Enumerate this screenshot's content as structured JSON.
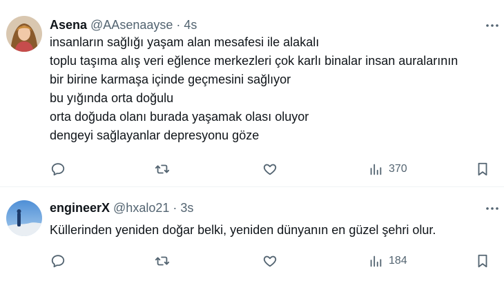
{
  "tweets": [
    {
      "author_name": "Asena",
      "handle": "@AAsenaayse",
      "separator": "·",
      "time": "4s",
      "lines": [
        "insanların sağlığı yaşam alan mesafesi ile alakalı",
        "toplu taşıma alış veri  eğlence merkezleri çok karlı binalar insan auralarının",
        "bir birine karmaşa içinde geçmesini sağlıyor",
        "bu yığında orta doğulu",
        "orta doğuda olanı burada yaşamak olası oluyor",
        "dengeyi sağlayanlar depresyonu göze"
      ],
      "views": "370",
      "icons": {
        "reply": "reply-icon",
        "retweet": "retweet-icon",
        "like": "heart-icon",
        "views": "views-icon",
        "bookmark": "bookmark-icon",
        "more": "more-icon"
      }
    },
    {
      "author_name": "engineerX",
      "handle": "@hxalo21",
      "separator": "·",
      "time": "3s",
      "lines": [
        "Küllerinden yeniden doğar belki, yeniden dünyanın en güzel şehri olur."
      ],
      "views": "184",
      "icons": {
        "reply": "reply-icon",
        "retweet": "retweet-icon",
        "like": "heart-icon",
        "views": "views-icon",
        "bookmark": "bookmark-icon",
        "more": "more-icon"
      }
    }
  ],
  "colors": {
    "text": "#0f1419",
    "secondary": "#536471",
    "divider": "#eff3f4",
    "background": "#ffffff"
  }
}
